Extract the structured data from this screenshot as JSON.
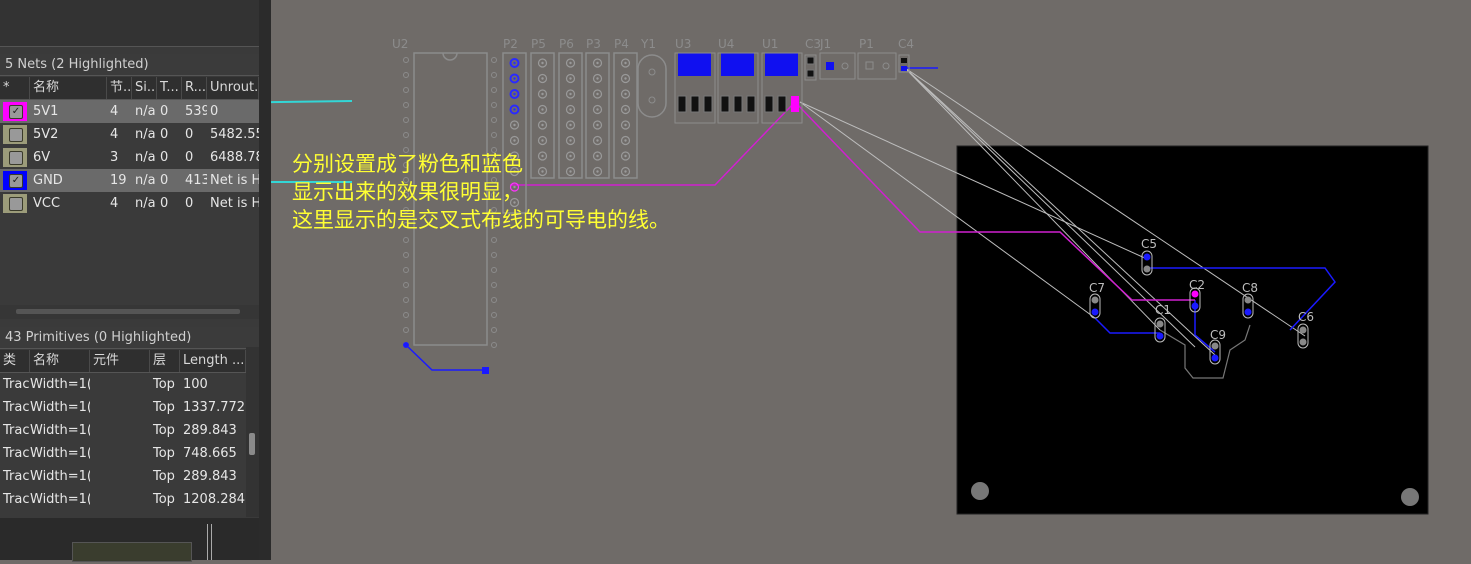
{
  "nets_panel": {
    "title": "5 Nets (2 Highlighted)",
    "columns": [
      "*",
      "名称",
      "节...",
      "Si...",
      "T...",
      "R...",
      "Unrout..."
    ],
    "rows": [
      {
        "name": "5V1",
        "nodes": "4",
        "si": "n/a",
        "t": "0",
        "r": "539",
        "unrouted": "0",
        "color": "#ff00ff",
        "checked": true,
        "selected": true
      },
      {
        "name": "5V2",
        "nodes": "4",
        "si": "n/a",
        "t": "0",
        "r": "0",
        "unrouted": "5482.55",
        "color": "#9c9c7a",
        "checked": false,
        "selected": false
      },
      {
        "name": "6V",
        "nodes": "3",
        "si": "n/a",
        "t": "0",
        "r": "0",
        "unrouted": "6488.78",
        "color": "#9c9c7a",
        "checked": false,
        "selected": false
      },
      {
        "name": "GND",
        "nodes": "19",
        "si": "n/a",
        "t": "0",
        "r": "413",
        "unrouted": "Net is H",
        "color": "#0000ff",
        "checked": true,
        "selected": true
      },
      {
        "name": "VCC",
        "nodes": "4",
        "si": "n/a",
        "t": "0",
        "r": "0",
        "unrouted": "Net is H",
        "color": "#9c9c7a",
        "checked": false,
        "selected": false
      }
    ]
  },
  "primitives_panel": {
    "title": "43 Primitives (0 Highlighted)",
    "columns": [
      "类",
      "名称",
      "元件",
      "层",
      "Length ..."
    ],
    "rows": [
      {
        "type": "Trac",
        "name": "Width=1(",
        "component": "",
        "layer": "Top",
        "length": "100"
      },
      {
        "type": "Trac",
        "name": "Width=1(",
        "component": "",
        "layer": "Top",
        "length": "1337.772"
      },
      {
        "type": "Trac",
        "name": "Width=1(",
        "component": "",
        "layer": "Top",
        "length": "289.843"
      },
      {
        "type": "Trac",
        "name": "Width=1(",
        "component": "",
        "layer": "Top",
        "length": "748.665"
      },
      {
        "type": "Trac",
        "name": "Width=1(",
        "component": "",
        "layer": "Top",
        "length": "289.843"
      },
      {
        "type": "Trac",
        "name": "Width=1(",
        "component": "",
        "layer": "Top",
        "length": "1208.284"
      }
    ]
  },
  "annotation": {
    "lines": [
      "分别设置成了粉色和蓝色",
      "显示出来的效果很明显，",
      "这里显示的是交叉式布线的可导电的线。"
    ],
    "color": "#ffff33",
    "arrow_color": "#33d6d6"
  },
  "designators": {
    "U2": "U2",
    "P2": "P2",
    "P5": "P5",
    "P6": "P6",
    "P3": "P3",
    "P4": "P4",
    "Y1": "Y1",
    "U3": "U3",
    "U4": "U4",
    "U1": "U1",
    "C3": "C3",
    "J1": "J1",
    "P1": "P1",
    "C4": "C4",
    "C5": "C5",
    "C2": "C2",
    "C8": "C8",
    "C7": "C7",
    "C1": "C1",
    "C9": "C9",
    "C6": "C6"
  },
  "colors": {
    "net_5v1": "#ff00ff",
    "net_gnd": "#0000ff",
    "board": "#000000",
    "workspace": "#6f6b68"
  }
}
